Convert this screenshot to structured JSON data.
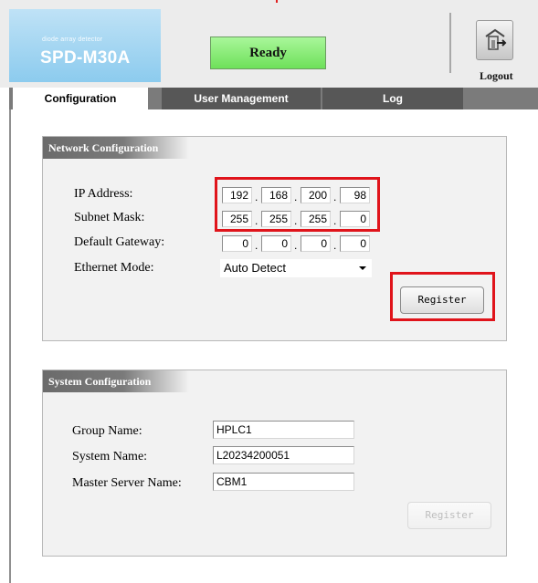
{
  "header": {
    "brand_subtitle": "diode array detector",
    "brand_name": "SPD-M30A",
    "status": "Ready",
    "logout_label": "Logout",
    "logout_icon": "logout-door-icon"
  },
  "tabs": [
    {
      "label": "Configuration",
      "active": true
    },
    {
      "label": "User Management",
      "active": false
    },
    {
      "label": "Log",
      "active": false
    }
  ],
  "network": {
    "title": "Network Configuration",
    "ip_label": "IP Address:",
    "ip": [
      "192",
      "168",
      "200",
      "98"
    ],
    "subnet_label": "Subnet Mask:",
    "subnet": [
      "255",
      "255",
      "255",
      "0"
    ],
    "gateway_label": "Default Gateway:",
    "gateway": [
      "0",
      "0",
      "0",
      "0"
    ],
    "ethernet_label": "Ethernet Mode:",
    "ethernet_mode": "Auto Detect",
    "register_label": "Register"
  },
  "system": {
    "title": "System Configuration",
    "group_label": "Group Name:",
    "group_value": "HPLC1",
    "system_label": "System Name:",
    "system_value": "L20234200051",
    "master_label": "Master Server Name:",
    "master_value": "CBM1",
    "register_label": "Register"
  },
  "colors": {
    "highlight": "#e0141b",
    "status_green": "#6ee05a",
    "brand_blue": "#8ccbee"
  }
}
